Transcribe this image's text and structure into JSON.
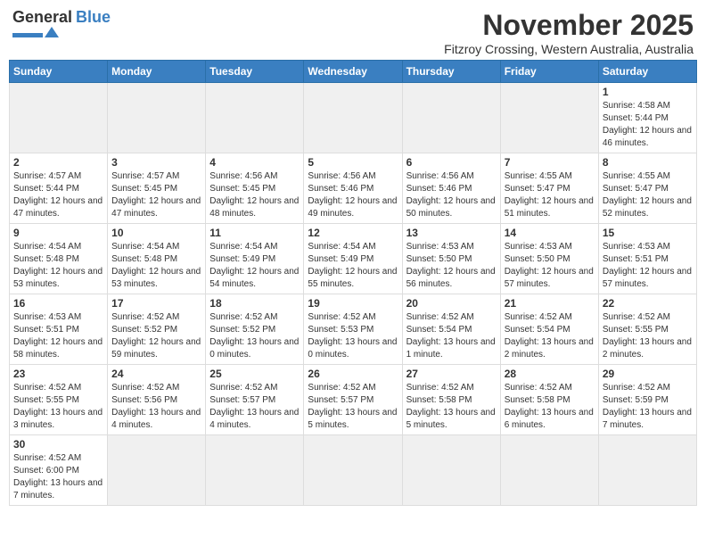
{
  "logo": {
    "text_general": "General",
    "text_blue": "Blue"
  },
  "title": "November 2025",
  "subtitle": "Fitzroy Crossing, Western Australia, Australia",
  "days_of_week": [
    "Sunday",
    "Monday",
    "Tuesday",
    "Wednesday",
    "Thursday",
    "Friday",
    "Saturday"
  ],
  "weeks": [
    [
      {
        "day": "",
        "info": ""
      },
      {
        "day": "",
        "info": ""
      },
      {
        "day": "",
        "info": ""
      },
      {
        "day": "",
        "info": ""
      },
      {
        "day": "",
        "info": ""
      },
      {
        "day": "",
        "info": ""
      },
      {
        "day": "1",
        "info": "Sunrise: 4:58 AM\nSunset: 5:44 PM\nDaylight: 12 hours\nand 46 minutes."
      }
    ],
    [
      {
        "day": "2",
        "info": "Sunrise: 4:57 AM\nSunset: 5:44 PM\nDaylight: 12 hours\nand 47 minutes."
      },
      {
        "day": "3",
        "info": "Sunrise: 4:57 AM\nSunset: 5:45 PM\nDaylight: 12 hours\nand 47 minutes."
      },
      {
        "day": "4",
        "info": "Sunrise: 4:56 AM\nSunset: 5:45 PM\nDaylight: 12 hours\nand 48 minutes."
      },
      {
        "day": "5",
        "info": "Sunrise: 4:56 AM\nSunset: 5:46 PM\nDaylight: 12 hours\nand 49 minutes."
      },
      {
        "day": "6",
        "info": "Sunrise: 4:56 AM\nSunset: 5:46 PM\nDaylight: 12 hours\nand 50 minutes."
      },
      {
        "day": "7",
        "info": "Sunrise: 4:55 AM\nSunset: 5:47 PM\nDaylight: 12 hours\nand 51 minutes."
      },
      {
        "day": "8",
        "info": "Sunrise: 4:55 AM\nSunset: 5:47 PM\nDaylight: 12 hours\nand 52 minutes."
      }
    ],
    [
      {
        "day": "9",
        "info": "Sunrise: 4:54 AM\nSunset: 5:48 PM\nDaylight: 12 hours\nand 53 minutes."
      },
      {
        "day": "10",
        "info": "Sunrise: 4:54 AM\nSunset: 5:48 PM\nDaylight: 12 hours\nand 53 minutes."
      },
      {
        "day": "11",
        "info": "Sunrise: 4:54 AM\nSunset: 5:49 PM\nDaylight: 12 hours\nand 54 minutes."
      },
      {
        "day": "12",
        "info": "Sunrise: 4:54 AM\nSunset: 5:49 PM\nDaylight: 12 hours\nand 55 minutes."
      },
      {
        "day": "13",
        "info": "Sunrise: 4:53 AM\nSunset: 5:50 PM\nDaylight: 12 hours\nand 56 minutes."
      },
      {
        "day": "14",
        "info": "Sunrise: 4:53 AM\nSunset: 5:50 PM\nDaylight: 12 hours\nand 57 minutes."
      },
      {
        "day": "15",
        "info": "Sunrise: 4:53 AM\nSunset: 5:51 PM\nDaylight: 12 hours\nand 57 minutes."
      }
    ],
    [
      {
        "day": "16",
        "info": "Sunrise: 4:53 AM\nSunset: 5:51 PM\nDaylight: 12 hours\nand 58 minutes."
      },
      {
        "day": "17",
        "info": "Sunrise: 4:52 AM\nSunset: 5:52 PM\nDaylight: 12 hours\nand 59 minutes."
      },
      {
        "day": "18",
        "info": "Sunrise: 4:52 AM\nSunset: 5:52 PM\nDaylight: 13 hours\nand 0 minutes."
      },
      {
        "day": "19",
        "info": "Sunrise: 4:52 AM\nSunset: 5:53 PM\nDaylight: 13 hours\nand 0 minutes."
      },
      {
        "day": "20",
        "info": "Sunrise: 4:52 AM\nSunset: 5:54 PM\nDaylight: 13 hours\nand 1 minute."
      },
      {
        "day": "21",
        "info": "Sunrise: 4:52 AM\nSunset: 5:54 PM\nDaylight: 13 hours\nand 2 minutes."
      },
      {
        "day": "22",
        "info": "Sunrise: 4:52 AM\nSunset: 5:55 PM\nDaylight: 13 hours\nand 2 minutes."
      }
    ],
    [
      {
        "day": "23",
        "info": "Sunrise: 4:52 AM\nSunset: 5:55 PM\nDaylight: 13 hours\nand 3 minutes."
      },
      {
        "day": "24",
        "info": "Sunrise: 4:52 AM\nSunset: 5:56 PM\nDaylight: 13 hours\nand 4 minutes."
      },
      {
        "day": "25",
        "info": "Sunrise: 4:52 AM\nSunset: 5:57 PM\nDaylight: 13 hours\nand 4 minutes."
      },
      {
        "day": "26",
        "info": "Sunrise: 4:52 AM\nSunset: 5:57 PM\nDaylight: 13 hours\nand 5 minutes."
      },
      {
        "day": "27",
        "info": "Sunrise: 4:52 AM\nSunset: 5:58 PM\nDaylight: 13 hours\nand 5 minutes."
      },
      {
        "day": "28",
        "info": "Sunrise: 4:52 AM\nSunset: 5:58 PM\nDaylight: 13 hours\nand 6 minutes."
      },
      {
        "day": "29",
        "info": "Sunrise: 4:52 AM\nSunset: 5:59 PM\nDaylight: 13 hours\nand 7 minutes."
      }
    ],
    [
      {
        "day": "30",
        "info": "Sunrise: 4:52 AM\nSunset: 6:00 PM\nDaylight: 13 hours\nand 7 minutes."
      },
      {
        "day": "",
        "info": ""
      },
      {
        "day": "",
        "info": ""
      },
      {
        "day": "",
        "info": ""
      },
      {
        "day": "",
        "info": ""
      },
      {
        "day": "",
        "info": ""
      },
      {
        "day": "",
        "info": ""
      }
    ]
  ]
}
